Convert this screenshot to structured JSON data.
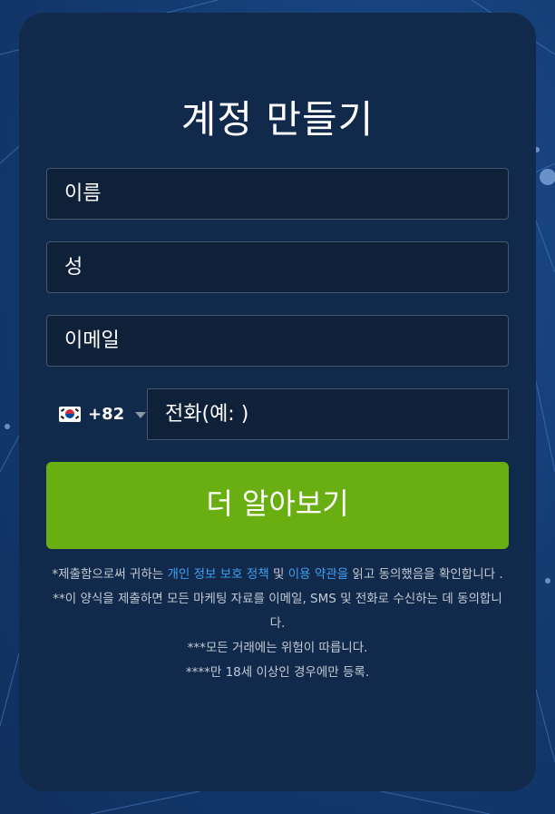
{
  "form": {
    "title": "계정 만들기",
    "first_name_placeholder": "이름",
    "last_name_placeholder": "성",
    "email_placeholder": "이메일",
    "country_code": "+82",
    "phone_placeholder": "전화(예: )",
    "submit_label": "더 알아보기"
  },
  "legal": {
    "line1_prefix": "*제출함으로써 귀하는 ",
    "privacy_link": "개인 정보 보호 정책",
    "line1_and": " 및 ",
    "terms_link": "이용 약관을",
    "line1_suffix": " 읽고 동의했음을 확인합니다 .",
    "line2": "**이 양식을 제출하면 모든 마케팅 자료를 이메일, SMS 및 전화로 수신하는 데 동의합니다.",
    "line3": "***모든 거래에는 위험이 따릅니다.",
    "line4": "****만 18세 이상인 경우에만 등록."
  },
  "colors": {
    "background": "#133b73",
    "card": "#112a4b",
    "input_bg": "#0f2039",
    "input_border": "#46566d",
    "cta": "#6aaf12",
    "link": "#3ea0f0"
  },
  "icons": {
    "flag": "south-korea-flag-icon",
    "dropdown": "chevron-down-icon"
  }
}
